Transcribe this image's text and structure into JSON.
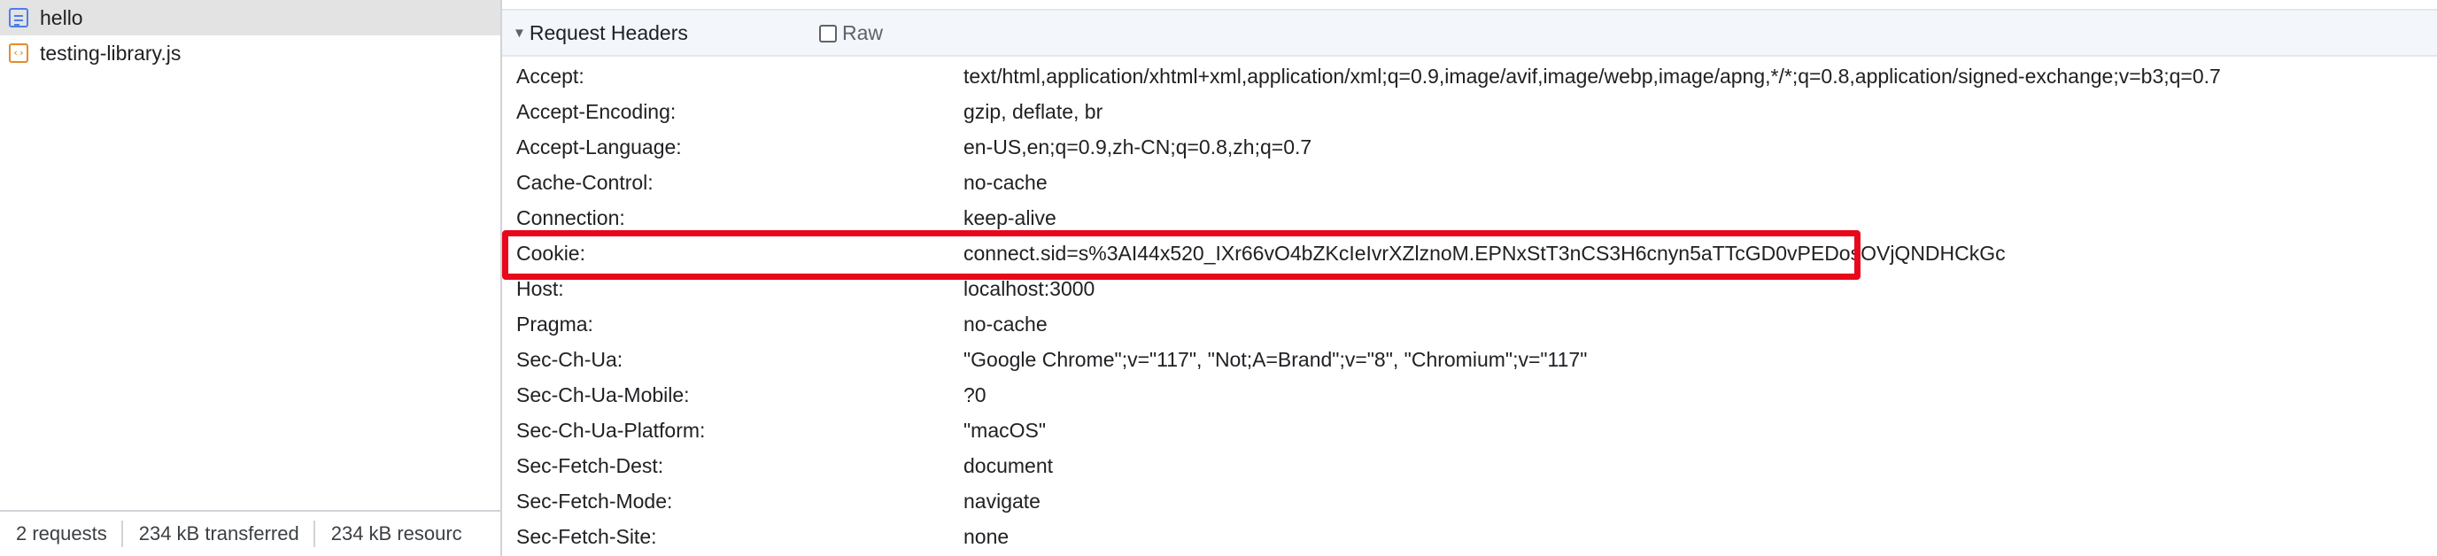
{
  "requests": [
    {
      "name": "hello",
      "icon": "document-icon",
      "selected": true
    },
    {
      "name": "testing-library.js",
      "icon": "script-icon",
      "selected": false
    }
  ],
  "status": {
    "requests": "2 requests",
    "transferred": "234 kB transferred",
    "resources": "234 kB resourc"
  },
  "section": {
    "title": "Request Headers",
    "raw_label": "Raw"
  },
  "headers": [
    {
      "name": "Accept:",
      "value": "text/html,application/xhtml+xml,application/xml;q=0.9,image/avif,image/webp,image/apng,*/*;q=0.8,application/signed-exchange;v=b3;q=0.7"
    },
    {
      "name": "Accept-Encoding:",
      "value": "gzip, deflate, br"
    },
    {
      "name": "Accept-Language:",
      "value": "en-US,en;q=0.9,zh-CN;q=0.8,zh;q=0.7"
    },
    {
      "name": "Cache-Control:",
      "value": "no-cache"
    },
    {
      "name": "Connection:",
      "value": "keep-alive"
    },
    {
      "name": "Cookie:",
      "value": "connect.sid=s%3AI44x520_IXr66vO4bZKcIeIvrXZlznoM.EPNxStT3nCS3H6cnyn5aTTcGD0vPEDosOVjQNDHCkGc"
    },
    {
      "name": "Host:",
      "value": "localhost:3000"
    },
    {
      "name": "Pragma:",
      "value": "no-cache"
    },
    {
      "name": "Sec-Ch-Ua:",
      "value": "\"Google Chrome\";v=\"117\", \"Not;A=Brand\";v=\"8\", \"Chromium\";v=\"117\""
    },
    {
      "name": "Sec-Ch-Ua-Mobile:",
      "value": "?0"
    },
    {
      "name": "Sec-Ch-Ua-Platform:",
      "value": "\"macOS\""
    },
    {
      "name": "Sec-Fetch-Dest:",
      "value": "document"
    },
    {
      "name": "Sec-Fetch-Mode:",
      "value": "navigate"
    },
    {
      "name": "Sec-Fetch-Site:",
      "value": "none"
    }
  ],
  "highlighted_header": "Cookie:",
  "colors": {
    "highlight": "#e8071b",
    "selected_row": "#e3e3e3",
    "document_icon": "#4f7ee8",
    "script_icon": "#e88a2e"
  }
}
